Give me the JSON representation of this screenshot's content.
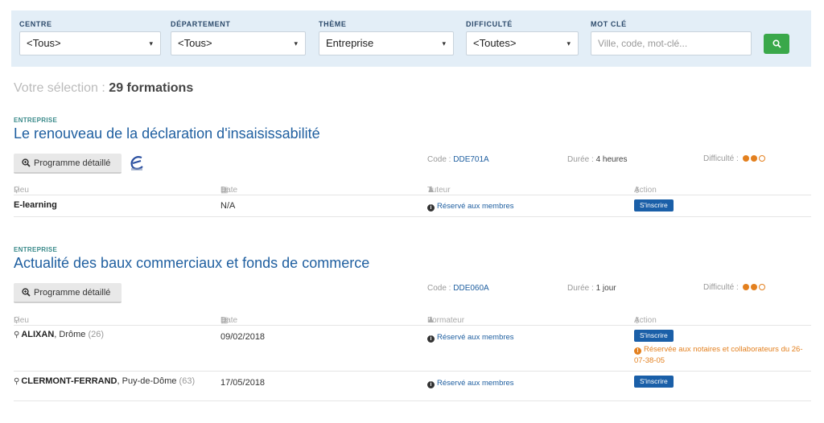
{
  "filters": {
    "centre": {
      "label": "CENTRE",
      "value": "<Tous>"
    },
    "departement": {
      "label": "DÉPARTEMENT",
      "value": "<Tous>"
    },
    "theme": {
      "label": "THÈME",
      "value": "Entreprise"
    },
    "difficulte": {
      "label": "DIFFICULTÉ",
      "value": "<Toutes>"
    },
    "motcle": {
      "label": "MOT CLÉ",
      "placeholder": "Ville, code, mot-clé..."
    },
    "search_icon": "magnifier-icon",
    "search_color": "#3aa84a"
  },
  "selection": {
    "prefix": "Votre sélection :",
    "count": "29 formations"
  },
  "courses": [
    {
      "theme": "ENTREPRISE",
      "title": "Le renouveau de la déclaration d'insaisissabilité",
      "program_label": "Programme détaillé",
      "elearning_logo": "e-learning-logo",
      "code_label": "Code :",
      "code": "DDE701A",
      "duree_label": "Durée :",
      "duree": "4 heures",
      "difficulte_label": "Difficulté :",
      "difficulty_level": 2,
      "difficulty_max": 3,
      "headers": {
        "lieu": "Lieu",
        "date": "Date",
        "person": "Tuteur",
        "action": "Action"
      },
      "rows": [
        {
          "lieu": "E-learning",
          "date": "N/A",
          "members": "Réservé aux membres",
          "button": "S'inscrire"
        }
      ]
    },
    {
      "theme": "ENTREPRISE",
      "title": "Actualité des baux commerciaux et fonds de commerce",
      "program_label": "Programme détaillé",
      "code_label": "Code :",
      "code": "DDE060A",
      "duree_label": "Durée :",
      "duree": "1 jour",
      "difficulte_label": "Difficulté :",
      "difficulty_level": 2,
      "difficulty_max": 3,
      "headers": {
        "lieu": "Lieu",
        "date": "Date",
        "person": "Formateur",
        "action": "Action"
      },
      "rows": [
        {
          "city": "ALIXAN",
          "dept": ", Drôme",
          "num": " (26)",
          "date": "09/02/2018",
          "members": "Réservé aux membres",
          "button": "S'inscrire",
          "warning": "Réservée aux notaires et collaborateurs du 26-07-38-05"
        },
        {
          "city": "CLERMONT-FERRAND",
          "dept": ", Puy-de-Dôme",
          "num": " (63)",
          "date": "17/05/2018",
          "members": "Réservé aux membres",
          "button": "S'inscrire"
        }
      ]
    }
  ],
  "colors": {
    "link": "#1f5fa0",
    "accent": "#e3801f",
    "button": "#1a5fa8",
    "filter_bg": "#e3eef7"
  }
}
